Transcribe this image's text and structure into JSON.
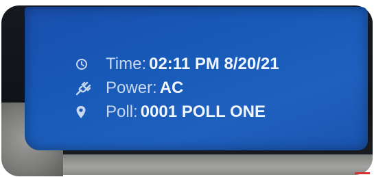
{
  "status": {
    "time": {
      "icon": "clock-icon",
      "label": "Time:",
      "value": "02:11 PM 8/20/21"
    },
    "power": {
      "icon": "plug-icon",
      "label": "Power:",
      "value": "AC"
    },
    "poll": {
      "icon": "location-pin-icon",
      "label": "Poll:",
      "value": "0001 POLL ONE"
    }
  },
  "colors": {
    "screen_blue": "#185ab8",
    "text": "#d7e3f5",
    "accent_red": "#d6332e"
  }
}
